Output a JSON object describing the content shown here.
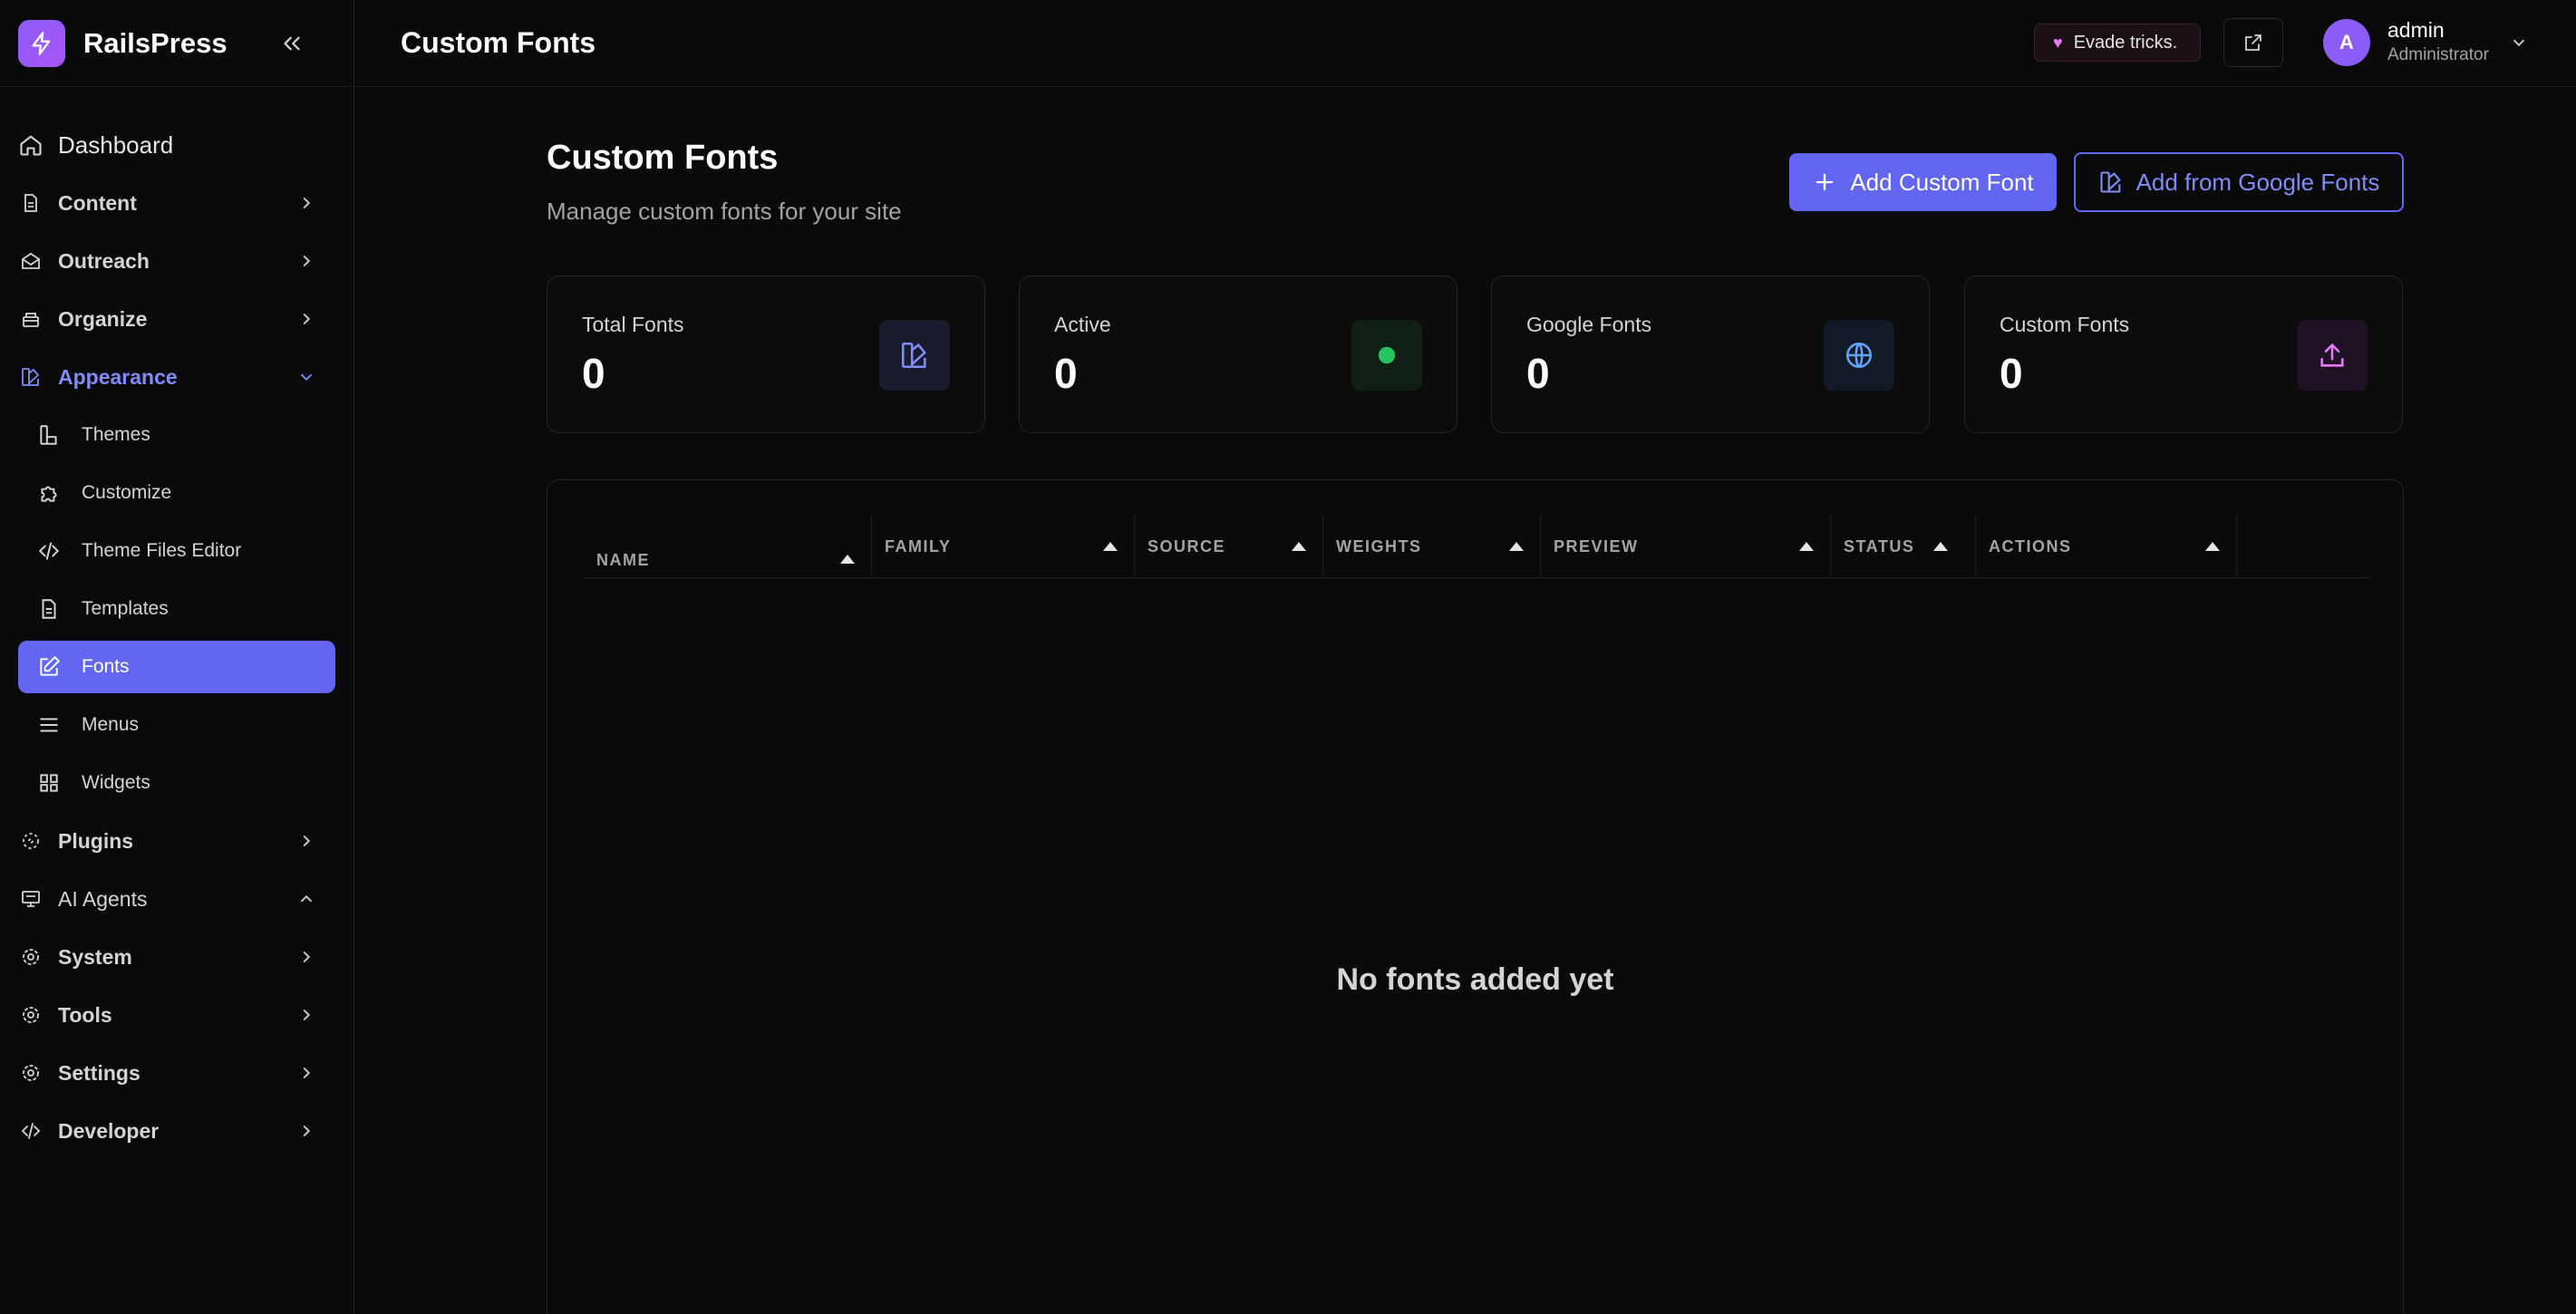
{
  "brand": {
    "name": "RailsPress"
  },
  "sidebar": {
    "top": {
      "label": "Dashboard"
    },
    "groups": [
      {
        "label": "Content"
      },
      {
        "label": "Outreach"
      },
      {
        "label": "Organize"
      },
      {
        "label": "Appearance"
      },
      {
        "label": "Plugins"
      },
      {
        "label": "AI Agents"
      },
      {
        "label": "System"
      },
      {
        "label": "Tools"
      },
      {
        "label": "Settings"
      },
      {
        "label": "Developer"
      }
    ],
    "appearance_items": [
      {
        "label": "Themes"
      },
      {
        "label": "Customize"
      },
      {
        "label": "Theme Files Editor"
      },
      {
        "label": "Templates"
      },
      {
        "label": "Fonts"
      },
      {
        "label": "Menus"
      },
      {
        "label": "Widgets"
      }
    ]
  },
  "header": {
    "title": "Custom Fonts",
    "pill": "Evade tricks.",
    "user": {
      "initial": "A",
      "name": "admin",
      "role": "Administrator"
    }
  },
  "main": {
    "title": "Custom Fonts",
    "subtitle": "Manage custom fonts for your site",
    "add_button": "Add Custom Font",
    "google_button": "Add from Google Fonts",
    "stats": [
      {
        "label": "Total Fonts",
        "value": "0"
      },
      {
        "label": "Active",
        "value": "0"
      },
      {
        "label": "Google Fonts",
        "value": "0"
      },
      {
        "label": "Custom Fonts",
        "value": "0"
      }
    ],
    "table": {
      "columns": [
        "NAME",
        "FAMILY",
        "SOURCE",
        "WEIGHTS",
        "PREVIEW",
        "STATUS",
        "ACTIONS"
      ],
      "empty_text": "No fonts added yet"
    }
  },
  "colors": {
    "accent": "#6366f1",
    "accent_text": "#818cf8",
    "active_green": "#22c55e",
    "globe_blue": "#60a5fa",
    "upload_pink": "#e879f9"
  }
}
